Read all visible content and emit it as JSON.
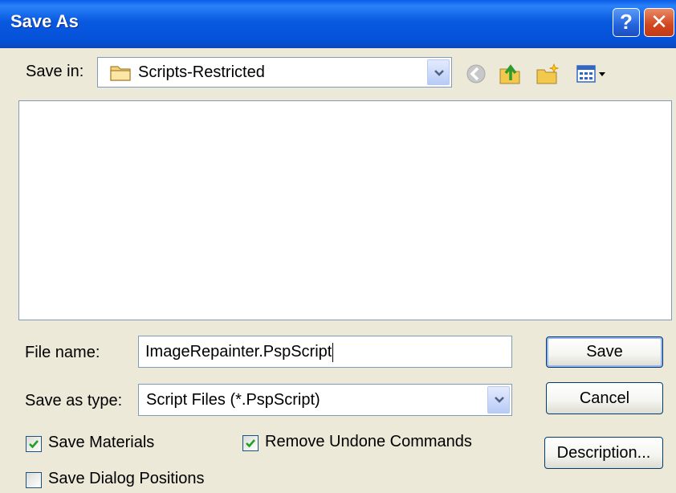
{
  "window": {
    "title": "Save As",
    "help_glyph": "?",
    "close_glyph": "✕"
  },
  "save_in": {
    "label": "Save in:",
    "value": "Scripts-Restricted",
    "icon": "folder-icon"
  },
  "toolbar": {
    "icons": [
      "back-icon",
      "up-folder-icon",
      "new-folder-icon",
      "view-menu-icon"
    ]
  },
  "file_list": {
    "items": []
  },
  "file_name": {
    "label": "File name:",
    "value": "ImageRepainter.PspScript"
  },
  "save_as_type": {
    "label": "Save as type:",
    "value": "Script Files (*.PspScript)"
  },
  "buttons": {
    "save": "Save",
    "cancel": "Cancel",
    "description": "Description..."
  },
  "options": {
    "save_materials": {
      "label": "Save Materials",
      "checked": true
    },
    "remove_undone": {
      "label": "Remove Undone Commands",
      "checked": true
    },
    "save_dialog_positions": {
      "label": "Save Dialog Positions",
      "checked": false
    }
  },
  "colors": {
    "titlebar": "#0859e0",
    "dialog_bg": "#ece9d8",
    "border": "#7f9db9",
    "check": "#21a121"
  }
}
